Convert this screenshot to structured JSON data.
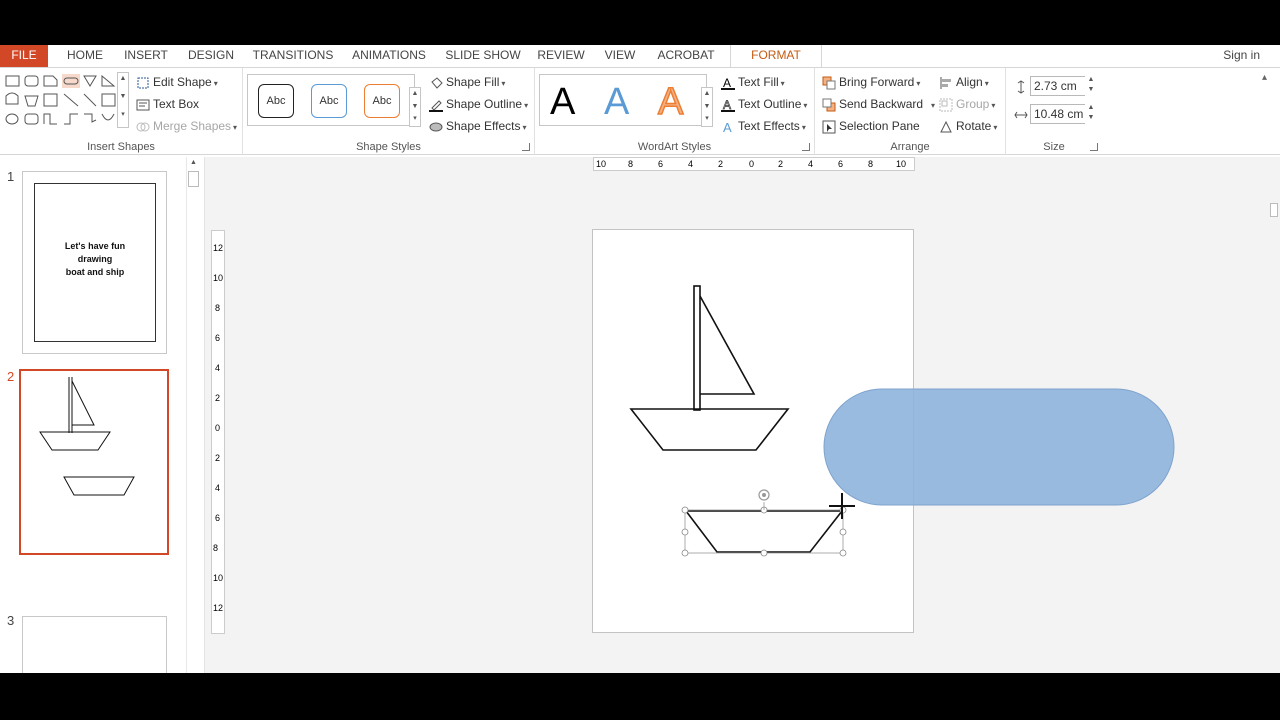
{
  "tabs": [
    {
      "label": "FILE"
    },
    {
      "label": "HOME"
    },
    {
      "label": "INSERT"
    },
    {
      "label": "DESIGN"
    },
    {
      "label": "TRANSITIONS"
    },
    {
      "label": "ANIMATIONS"
    },
    {
      "label": "SLIDE SHOW"
    },
    {
      "label": "REVIEW"
    },
    {
      "label": "VIEW"
    },
    {
      "label": "ACROBAT"
    },
    {
      "label": "FORMAT"
    }
  ],
  "sign_in": "Sign in",
  "insert_shapes": {
    "edit_shape": "Edit Shape",
    "text_box": "Text Box",
    "merge_shapes": "Merge Shapes",
    "label": "Insert Shapes"
  },
  "shape_styles": {
    "previews": [
      "Abc",
      "Abc",
      "Abc"
    ],
    "shape_fill": "Shape Fill",
    "shape_outline": "Shape Outline",
    "shape_effects": "Shape Effects",
    "label": "Shape Styles"
  },
  "wordart": {
    "letters": [
      "A",
      "A",
      "A"
    ],
    "text_fill": "Text Fill",
    "text_outline": "Text Outline",
    "text_effects": "Text Effects",
    "label": "WordArt Styles"
  },
  "arrange": {
    "bring_forward": "Bring Forward",
    "send_backward": "Send Backward",
    "selection_pane": "Selection Pane",
    "align": "Align",
    "group": "Group",
    "rotate": "Rotate",
    "label": "Arrange"
  },
  "size": {
    "height": "2.73 cm",
    "width": "10.48 cm",
    "label": "Size"
  },
  "slides": [
    {
      "number": "1",
      "title_lines": [
        "Let's have fun",
        "drawing",
        "boat and ship"
      ]
    },
    {
      "number": "2"
    },
    {
      "number": "3"
    }
  ],
  "ruler": {
    "horizontal": [
      "10",
      "8",
      "6",
      "4",
      "2",
      "0",
      "2",
      "4",
      "6",
      "8",
      "10"
    ],
    "vertical": [
      "12",
      "10",
      "8",
      "6",
      "4",
      "2",
      "0",
      "2",
      "4",
      "6",
      "8",
      "10",
      "12"
    ]
  },
  "colors": {
    "accent": "#d24726",
    "format_tab": "#c55a11",
    "rounded_rect_fill": "#8fb4dd"
  }
}
